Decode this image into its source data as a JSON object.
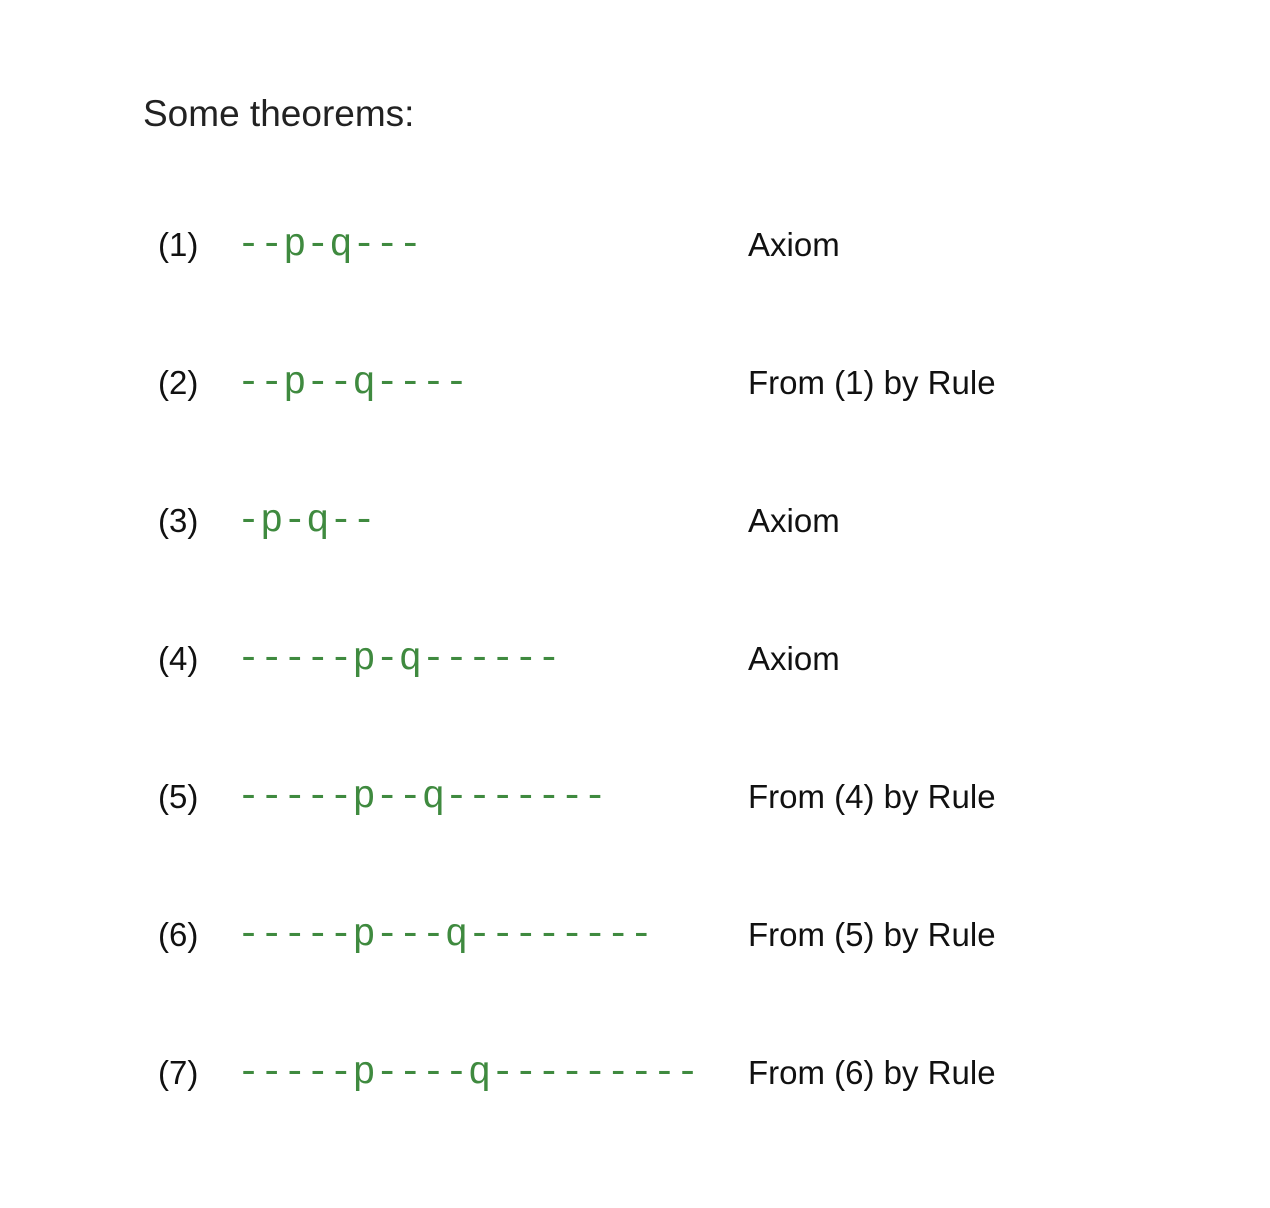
{
  "heading": "Some theorems:",
  "theorems": [
    {
      "number": "(1)",
      "formula": "--p-q---",
      "justification": "Axiom"
    },
    {
      "number": "(2)",
      "formula": "--p--q----",
      "justification": "From (1) by Rule"
    },
    {
      "number": "(3)",
      "formula": "-p-q--",
      "justification": "Axiom"
    },
    {
      "number": "(4)",
      "formula": "-----p-q------",
      "justification": "Axiom"
    },
    {
      "number": "(5)",
      "formula": "-----p--q-------",
      "justification": "From (4) by Rule"
    },
    {
      "number": "(6)",
      "formula": "-----p---q--------",
      "justification": "From (5) by Rule"
    },
    {
      "number": "(7)",
      "formula": "-----p----q---------",
      "justification": "From (6) by Rule"
    }
  ],
  "colors": {
    "formula": "#3f8a3f",
    "text": "#111111",
    "heading": "#222222",
    "background": "#ffffff"
  }
}
